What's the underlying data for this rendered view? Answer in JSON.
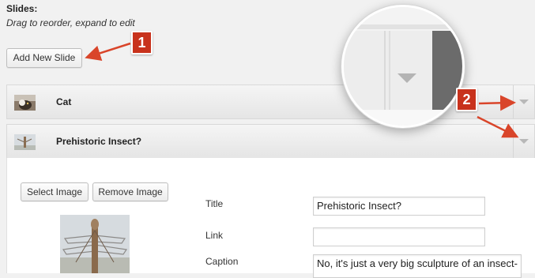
{
  "slides": {
    "label": "Slides:",
    "hint": "Drag to reorder, expand to edit",
    "add_button": "Add New Slide"
  },
  "callouts": {
    "one": "1",
    "two": "2"
  },
  "rows": [
    {
      "title": "Cat",
      "thumb_icon": "cat-thumbnail-icon"
    },
    {
      "title": "Prehistoric Insect?",
      "thumb_icon": "insect-thumbnail-icon"
    }
  ],
  "editor": {
    "select_image_button": "Select Image",
    "remove_image_button": "Remove Image",
    "fields": {
      "title_label": "Title",
      "title_value": "Prehistoric Insect?",
      "link_label": "Link",
      "link_value": "",
      "caption_label": "Caption",
      "caption_value": "No, it's just a very big sculpture of an insect-"
    }
  },
  "colors": {
    "callout": "#c8321c",
    "arrow": "#d9452a"
  }
}
